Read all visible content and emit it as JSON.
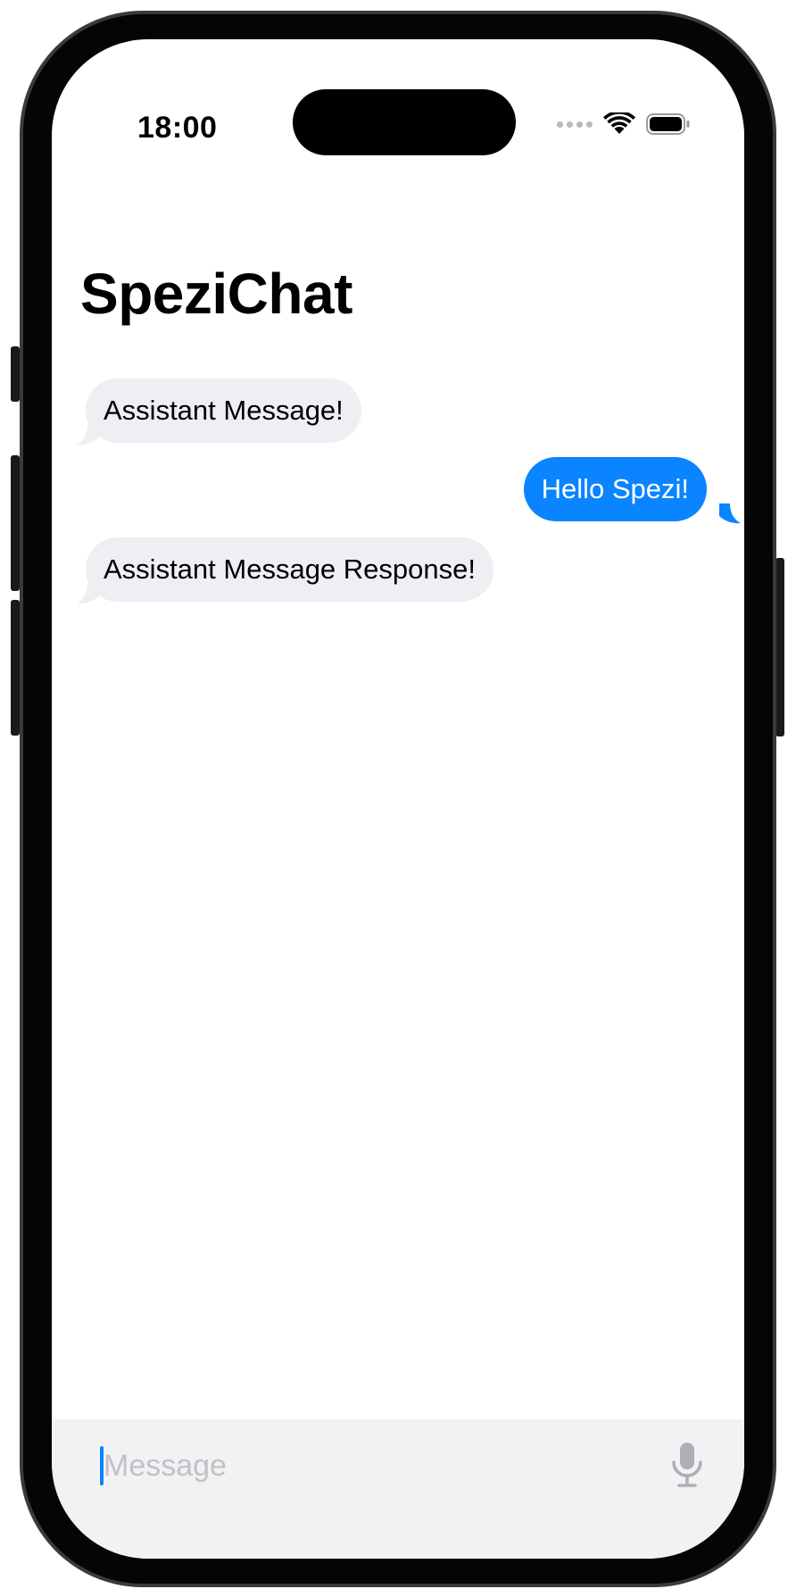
{
  "status_bar": {
    "time": "18:00",
    "icons": [
      "cellular-dots-icon",
      "wifi-icon",
      "battery-icon"
    ]
  },
  "header": {
    "title": "SpeziChat"
  },
  "messages": [
    {
      "role": "assistant",
      "text": "Assistant Message!"
    },
    {
      "role": "user",
      "text": "Hello Spezi!"
    },
    {
      "role": "assistant",
      "text": "Assistant Message Response!"
    }
  ],
  "input": {
    "placeholder": "Message",
    "value": "",
    "mic_icon": "microphone-icon"
  },
  "colors": {
    "user_bubble": "#0a84ff",
    "assistant_bubble": "#eeeef3",
    "input_bar": "#f2f2f4",
    "placeholder": "#c1c1c6"
  }
}
